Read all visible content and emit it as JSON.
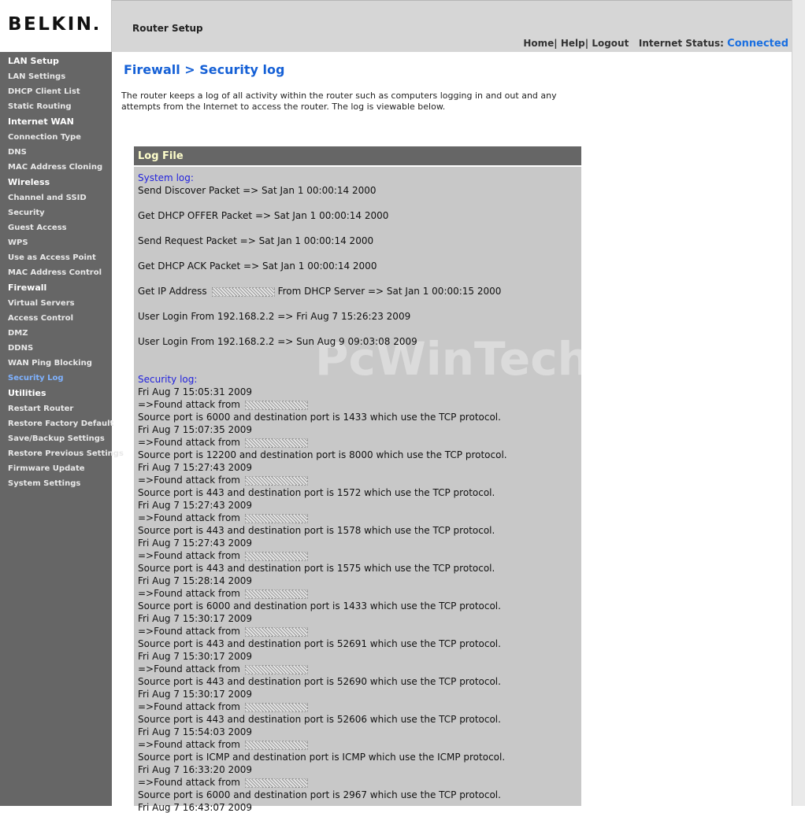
{
  "header": {
    "logo": "BELKIN",
    "title": "Router Setup",
    "links": [
      "Home",
      "Help",
      "Logout"
    ],
    "status_label": "Internet Status:",
    "status_value": "Connected"
  },
  "sidebar": {
    "sections": [
      {
        "label": "LAN Setup",
        "items": [
          "LAN Settings",
          "DHCP Client List",
          "Static Routing"
        ]
      },
      {
        "label": "Internet WAN",
        "items": [
          "Connection Type",
          "DNS",
          "MAC Address Cloning"
        ]
      },
      {
        "label": "Wireless",
        "items": [
          "Channel and SSID",
          "Security",
          "Guest Access",
          "WPS",
          "Use as Access Point",
          "MAC Address Control"
        ]
      },
      {
        "label": "Firewall",
        "items": [
          "Virtual Servers",
          "Access Control",
          "DMZ",
          "DDNS",
          "WAN Ping Blocking",
          "Security Log"
        ]
      },
      {
        "label": "Utilities",
        "items": [
          "Restart Router",
          "Restore Factory Default",
          "Save/Backup Settings",
          "Restore Previous Settings",
          "Firmware Update",
          "System Settings"
        ]
      }
    ],
    "active_item": "Security Log"
  },
  "main": {
    "page_title": "Firewall > Security log",
    "intro": "The router keeps a log of all activity within the router such as computers logging in and out and any attempts from the Internet to access the router. The log is viewable below."
  },
  "log": {
    "title": "Log File",
    "watermark": "PcWinTech.com",
    "system_label": "System log:",
    "system": [
      "Send Discover Packet => Sat Jan 1 00:00:14 2000",
      "Get DHCP OFFER Packet => Sat Jan 1 00:00:14 2000",
      "Send Request Packet => Sat Jan 1 00:00:14 2000",
      "Get DHCP ACK Packet => Sat Jan 1 00:00:14 2000",
      {
        "pre": "Get IP Address",
        "post": "From DHCP Server => Sat Jan 1 00:00:15 2000"
      },
      "User Login From 192.168.2.2 => Fri Aug 7 15:26:23 2009",
      "User Login From 192.168.2.2 => Sun Aug 9 09:03:08 2009"
    ],
    "security_label": "Security log:",
    "found_text": "=>Found attack from",
    "security": [
      {
        "time": "Fri Aug 7 15:05:31 2009",
        "desc": "Source port is 6000 and destination port is 1433 which use the TCP protocol."
      },
      {
        "time": "Fri Aug 7 15:07:35 2009",
        "desc": "Source port is 12200 and destination port is 8000 which use the TCP protocol."
      },
      {
        "time": "Fri Aug 7 15:27:43 2009",
        "desc": "Source port is 443 and destination port is 1572 which use the TCP protocol."
      },
      {
        "time": "Fri Aug 7 15:27:43 2009",
        "desc": "Source port is 443 and destination port is 1578 which use the TCP protocol."
      },
      {
        "time": "Fri Aug 7 15:27:43 2009",
        "desc": "Source port is 443 and destination port is 1575 which use the TCP protocol."
      },
      {
        "time": "Fri Aug 7 15:28:14 2009",
        "desc": "Source port is 6000 and destination port is 1433 which use the TCP protocol."
      },
      {
        "time": "Fri Aug 7 15:30:17 2009",
        "desc": "Source port is 443 and destination port is 52691 which use the TCP protocol."
      },
      {
        "time": "Fri Aug 7 15:30:17 2009",
        "desc": "Source port is 443 and destination port is 52690 which use the TCP protocol."
      },
      {
        "time": "Fri Aug 7 15:30:17 2009",
        "desc": "Source port is 443 and destination port is 52606 which use the TCP protocol."
      },
      {
        "time": "Fri Aug 7 15:54:03 2009",
        "desc": "Source port is ICMP and destination port is ICMP which use the ICMP protocol."
      },
      {
        "time": "Fri Aug 7 16:33:20 2009",
        "desc": "Source port is 6000 and destination port is 2967 which use the TCP protocol."
      },
      {
        "time": "Fri Aug 7 16:43:07 2009",
        "desc": ""
      }
    ]
  }
}
